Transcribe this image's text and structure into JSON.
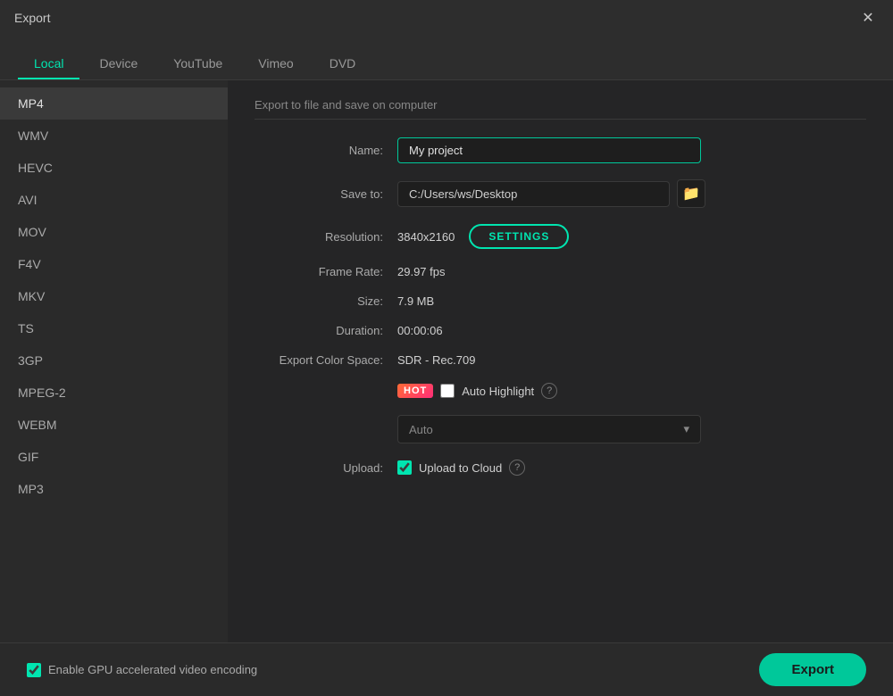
{
  "window": {
    "title": "Export",
    "close_label": "✕"
  },
  "tabs": [
    {
      "id": "local",
      "label": "Local",
      "active": true
    },
    {
      "id": "device",
      "label": "Device",
      "active": false
    },
    {
      "id": "youtube",
      "label": "YouTube",
      "active": false
    },
    {
      "id": "vimeo",
      "label": "Vimeo",
      "active": false
    },
    {
      "id": "dvd",
      "label": "DVD",
      "active": false
    }
  ],
  "sidebar": {
    "items": [
      {
        "id": "mp4",
        "label": "MP4",
        "active": true
      },
      {
        "id": "wmv",
        "label": "WMV"
      },
      {
        "id": "hevc",
        "label": "HEVC"
      },
      {
        "id": "avi",
        "label": "AVI"
      },
      {
        "id": "mov",
        "label": "MOV"
      },
      {
        "id": "f4v",
        "label": "F4V"
      },
      {
        "id": "mkv",
        "label": "MKV"
      },
      {
        "id": "ts",
        "label": "TS"
      },
      {
        "id": "3gp",
        "label": "3GP"
      },
      {
        "id": "mpeg2",
        "label": "MPEG-2"
      },
      {
        "id": "webm",
        "label": "WEBM"
      },
      {
        "id": "gif",
        "label": "GIF"
      },
      {
        "id": "mp3",
        "label": "MP3"
      }
    ]
  },
  "form": {
    "section_title": "Export to file and save on computer",
    "name_label": "Name:",
    "name_value": "My project",
    "save_to_label": "Save to:",
    "save_to_path": "C:/Users/ws/Desktop",
    "resolution_label": "Resolution:",
    "resolution_value": "3840x2160",
    "settings_btn": "SETTINGS",
    "frame_rate_label": "Frame Rate:",
    "frame_rate_value": "29.97 fps",
    "size_label": "Size:",
    "size_value": "7.9 MB",
    "duration_label": "Duration:",
    "duration_value": "00:00:06",
    "color_space_label": "Export Color Space:",
    "color_space_value": "SDR - Rec.709",
    "hot_badge": "HOT",
    "auto_highlight_label": "Auto Highlight",
    "auto_dropdown_value": "Auto",
    "upload_label": "Upload:",
    "upload_to_cloud_label": "Upload to Cloud"
  },
  "bottom_bar": {
    "gpu_label": "Enable GPU accelerated video encoding",
    "export_btn": "Export"
  },
  "icons": {
    "folder": "🗁",
    "chevron_down": "▾",
    "question": "?",
    "checkbox_checked": "✔"
  }
}
